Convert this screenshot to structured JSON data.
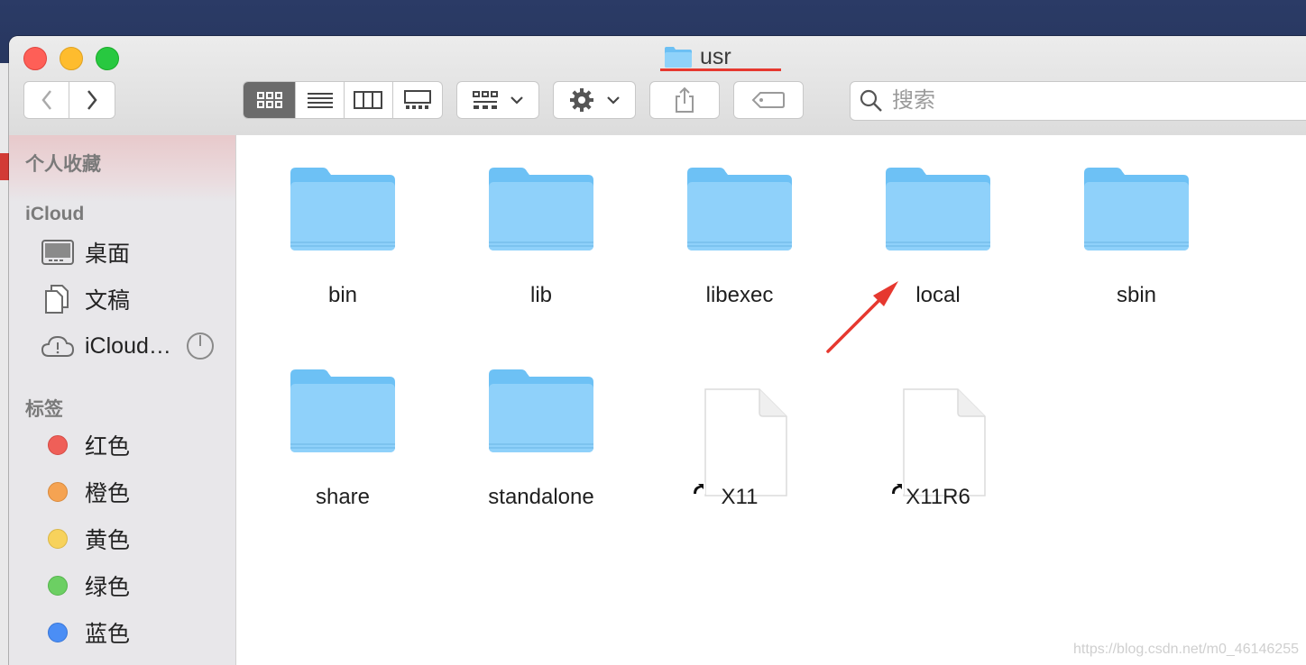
{
  "window": {
    "title": "usr"
  },
  "toolbar": {
    "back": "back",
    "forward": "forward",
    "views": [
      "icon-view",
      "list-view",
      "column-view",
      "gallery-view"
    ],
    "active_view": "icon-view",
    "group_button": "group-by",
    "action_button": "action",
    "share_button": "share",
    "tags_button": "tags"
  },
  "search": {
    "placeholder": "搜索"
  },
  "sidebar": {
    "favorites_heading": "个人收藏",
    "icloud_heading": "iCloud",
    "icloud_items": [
      {
        "label": "桌面",
        "icon": "desktop-icon"
      },
      {
        "label": "文稿",
        "icon": "document-icon"
      },
      {
        "label": "iCloud…",
        "icon": "cloud-icon"
      }
    ],
    "tags_heading": "标签",
    "tags": [
      {
        "label": "红色",
        "color": "#ef5f58"
      },
      {
        "label": "橙色",
        "color": "#f5a352"
      },
      {
        "label": "黄色",
        "color": "#f7d25c"
      },
      {
        "label": "绿色",
        "color": "#6ccf63"
      },
      {
        "label": "蓝色",
        "color": "#4b8ef5"
      }
    ]
  },
  "files": [
    {
      "name": "bin",
      "kind": "folder"
    },
    {
      "name": "lib",
      "kind": "folder"
    },
    {
      "name": "libexec",
      "kind": "folder"
    },
    {
      "name": "local",
      "kind": "folder"
    },
    {
      "name": "sbin",
      "kind": "folder"
    },
    {
      "name": "share",
      "kind": "folder"
    },
    {
      "name": "standalone",
      "kind": "folder"
    },
    {
      "name": "X11",
      "kind": "alias"
    },
    {
      "name": "X11R6",
      "kind": "alias"
    }
  ],
  "annotation": {
    "arrow_target": "local",
    "arrow_color": "#e6382f"
  },
  "watermark": "https://blog.csdn.net/m0_46146255"
}
